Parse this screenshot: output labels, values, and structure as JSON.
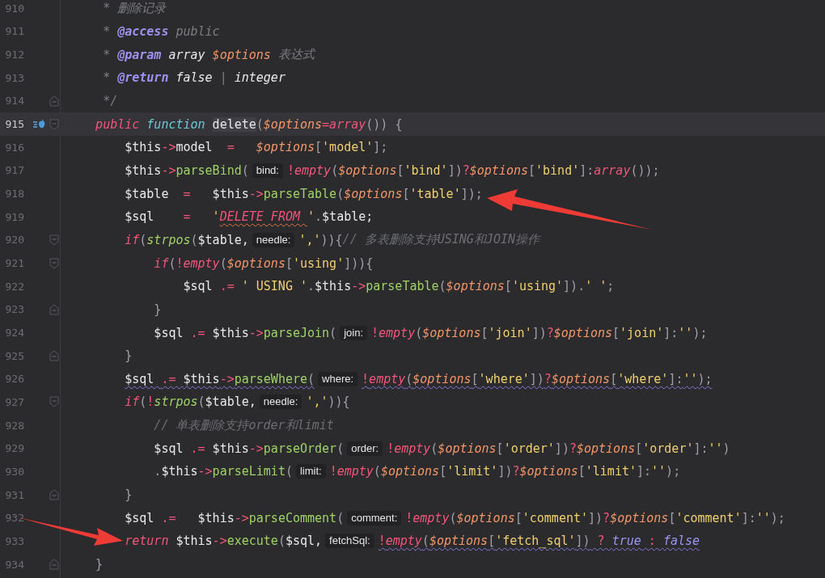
{
  "editor": {
    "lines": [
      {
        "number": "910",
        "kind": "doc",
        "current": false,
        "tokens": [
          {
            "kind": "doc",
            "text": "* 删除记录"
          }
        ]
      },
      {
        "number": "911",
        "kind": "doc",
        "current": false,
        "tokens": [
          {
            "kind": "doc",
            "text": "* "
          },
          {
            "kind": "tag",
            "text": "@access"
          },
          {
            "kind": "doc",
            "text": " public"
          }
        ]
      },
      {
        "number": "912",
        "kind": "doc",
        "current": false,
        "tokens": [
          {
            "kind": "doc",
            "text": "* "
          },
          {
            "kind": "tag",
            "text": "@param"
          },
          {
            "kind": "type",
            "text": " array "
          },
          {
            "kind": "opt",
            "text": "$options"
          },
          {
            "kind": "doc",
            "text": " 表达式"
          }
        ]
      },
      {
        "number": "913",
        "kind": "doc",
        "current": false,
        "tokens": [
          {
            "kind": "doc",
            "text": "* "
          },
          {
            "kind": "tag",
            "text": "@return"
          },
          {
            "kind": "type",
            "text": " false "
          },
          {
            "kind": "doc",
            "text": "|"
          },
          {
            "kind": "type",
            "text": " integer"
          }
        ]
      },
      {
        "number": "914",
        "kind": "doc",
        "current": false,
        "fold_close": true,
        "tokens": [
          {
            "kind": "doc",
            "text": "*/"
          }
        ]
      },
      {
        "number": "915",
        "kind": "code",
        "current": true,
        "implements_marker": true,
        "fold_open": true,
        "tokens": [
          {
            "kind": "kw",
            "text": "public"
          },
          {
            "kind": "decl",
            "text": " function "
          },
          {
            "kind": "name",
            "text": "delete",
            "highlighted": true
          },
          {
            "kind": "punc",
            "text": "("
          },
          {
            "kind": "opt",
            "text": "$options"
          },
          {
            "kind": "op",
            "text": "="
          },
          {
            "kind": "builtin",
            "text": "array"
          },
          {
            "kind": "punc",
            "text": "()) {"
          }
        ],
        "children": [
          {
            "number": "916",
            "kind": "code",
            "current": false,
            "tokens": [
              {
                "kind": "var",
                "text": "$this"
              },
              {
                "kind": "op",
                "text": "->"
              },
              {
                "kind": "var",
                "text": "model  "
              },
              {
                "kind": "op",
                "text": "=   "
              },
              {
                "kind": "opt",
                "text": "$options"
              },
              {
                "kind": "punc",
                "text": "["
              },
              {
                "kind": "str",
                "text": "'model'"
              },
              {
                "kind": "punc",
                "text": "];"
              }
            ]
          },
          {
            "number": "917",
            "kind": "code",
            "current": false,
            "tokens": [
              {
                "kind": "var",
                "text": "$this"
              },
              {
                "kind": "op",
                "text": "->"
              },
              {
                "kind": "fn",
                "text": "parseBind"
              },
              {
                "kind": "punc",
                "text": "("
              },
              {
                "kind": "hint",
                "text": "bind:"
              },
              {
                "kind": "op",
                "text": "!"
              },
              {
                "kind": "builtin",
                "text": "empty"
              },
              {
                "kind": "punc",
                "text": "("
              },
              {
                "kind": "opt",
                "text": "$options"
              },
              {
                "kind": "punc",
                "text": "["
              },
              {
                "kind": "str",
                "text": "'bind'"
              },
              {
                "kind": "punc",
                "text": "])"
              },
              {
                "kind": "op",
                "text": "?"
              },
              {
                "kind": "opt",
                "text": "$options"
              },
              {
                "kind": "punc",
                "text": "["
              },
              {
                "kind": "str",
                "text": "'bind'"
              },
              {
                "kind": "punc",
                "text": "]:"
              },
              {
                "kind": "builtin",
                "text": "array"
              },
              {
                "kind": "punc",
                "text": "());"
              }
            ]
          },
          {
            "number": "918",
            "kind": "code",
            "current": false,
            "arrow_from_right": true,
            "tokens": [
              {
                "kind": "var",
                "text": "$table  "
              },
              {
                "kind": "op",
                "text": "=   "
              },
              {
                "kind": "var",
                "text": "$this"
              },
              {
                "kind": "op",
                "text": "->"
              },
              {
                "kind": "fn",
                "text": "parseTable"
              },
              {
                "kind": "punc",
                "text": "("
              },
              {
                "kind": "opt",
                "text": "$options"
              },
              {
                "kind": "punc",
                "text": "["
              },
              {
                "kind": "str",
                "text": "'table'"
              },
              {
                "kind": "punc",
                "text": "]);"
              }
            ]
          },
          {
            "number": "919",
            "kind": "code",
            "current": false,
            "tokens": [
              {
                "kind": "var",
                "text": "$sql    "
              },
              {
                "kind": "op",
                "text": "=   "
              },
              {
                "kind": "str",
                "text": "'"
              },
              {
                "kind": "sql",
                "text": "DELETE FROM ",
                "typo": true
              },
              {
                "kind": "str",
                "text": "'"
              },
              {
                "kind": "punc",
                "text": "."
              },
              {
                "kind": "var",
                "text": "$table;"
              }
            ]
          },
          {
            "number": "920",
            "kind": "code",
            "current": false,
            "fold_open": true,
            "tokens": [
              {
                "kind": "kw",
                "text": "if"
              },
              {
                "kind": "punc",
                "text": "("
              },
              {
                "kind": "call",
                "text": "strpos"
              },
              {
                "kind": "punc",
                "text": "("
              },
              {
                "kind": "var",
                "text": "$table,"
              },
              {
                "kind": "hint",
                "text": "needle:"
              },
              {
                "kind": "str",
                "text": "','"
              },
              {
                "kind": "punc",
                "text": ")){"
              },
              {
                "kind": "comment",
                "text": "// 多表删除支持USING和JOIN操作"
              }
            ],
            "children": [
              {
                "number": "921",
                "kind": "code",
                "current": false,
                "fold_open": true,
                "tokens": [
                  {
                    "kind": "kw",
                    "text": "if"
                  },
                  {
                    "kind": "punc",
                    "text": "("
                  },
                  {
                    "kind": "op",
                    "text": "!"
                  },
                  {
                    "kind": "builtin",
                    "text": "empty"
                  },
                  {
                    "kind": "punc",
                    "text": "("
                  },
                  {
                    "kind": "opt",
                    "text": "$options"
                  },
                  {
                    "kind": "punc",
                    "text": "["
                  },
                  {
                    "kind": "str",
                    "text": "'using'"
                  },
                  {
                    "kind": "punc",
                    "text": "])){"
                  }
                ],
                "children": [
                  {
                    "number": "922",
                    "kind": "code",
                    "current": false,
                    "tokens": [
                      {
                        "kind": "var",
                        "text": "$sql "
                      },
                      {
                        "kind": "op",
                        "text": ".= "
                      },
                      {
                        "kind": "str",
                        "text": "' USING '"
                      },
                      {
                        "kind": "punc",
                        "text": "."
                      },
                      {
                        "kind": "var",
                        "text": "$this"
                      },
                      {
                        "kind": "op",
                        "text": "->"
                      },
                      {
                        "kind": "fn",
                        "text": "parseTable"
                      },
                      {
                        "kind": "punc",
                        "text": "("
                      },
                      {
                        "kind": "opt",
                        "text": "$options"
                      },
                      {
                        "kind": "punc",
                        "text": "["
                      },
                      {
                        "kind": "str",
                        "text": "'using'"
                      },
                      {
                        "kind": "punc",
                        "text": "])."
                      },
                      {
                        "kind": "str",
                        "text": "' '"
                      },
                      {
                        "kind": "punc",
                        "text": ";"
                      }
                    ]
                  }
                ]
              },
              {
                "number": "923",
                "kind": "code",
                "current": false,
                "fold_close": true,
                "tokens": [
                  {
                    "kind": "punc",
                    "text": "}"
                  }
                ]
              },
              {
                "number": "924",
                "kind": "code",
                "current": false,
                "tokens": [
                  {
                    "kind": "var",
                    "text": "$sql "
                  },
                  {
                    "kind": "op",
                    "text": ".= "
                  },
                  {
                    "kind": "var",
                    "text": "$this"
                  },
                  {
                    "kind": "op",
                    "text": "->"
                  },
                  {
                    "kind": "fn",
                    "text": "parseJoin"
                  },
                  {
                    "kind": "punc",
                    "text": "("
                  },
                  {
                    "kind": "hint",
                    "text": "join:"
                  },
                  {
                    "kind": "op",
                    "text": "!"
                  },
                  {
                    "kind": "builtin",
                    "text": "empty"
                  },
                  {
                    "kind": "punc",
                    "text": "("
                  },
                  {
                    "kind": "opt",
                    "text": "$options"
                  },
                  {
                    "kind": "punc",
                    "text": "["
                  },
                  {
                    "kind": "str",
                    "text": "'join'"
                  },
                  {
                    "kind": "punc",
                    "text": "])"
                  },
                  {
                    "kind": "op",
                    "text": "?"
                  },
                  {
                    "kind": "opt",
                    "text": "$options"
                  },
                  {
                    "kind": "punc",
                    "text": "["
                  },
                  {
                    "kind": "str",
                    "text": "'join'"
                  },
                  {
                    "kind": "punc",
                    "text": "]:"
                  },
                  {
                    "kind": "str",
                    "text": "''"
                  },
                  {
                    "kind": "punc",
                    "text": ");"
                  }
                ]
              }
            ]
          },
          {
            "number": "925",
            "kind": "code",
            "current": false,
            "fold_close": true,
            "tokens": [
              {
                "kind": "punc",
                "text": "}"
              }
            ]
          },
          {
            "number": "926",
            "kind": "code",
            "current": false,
            "tokens": [
              {
                "kind": "var",
                "text": "$sql ",
                "warning": true
              },
              {
                "kind": "op",
                "text": ".= ",
                "warning": true
              },
              {
                "kind": "var",
                "text": "$this",
                "warning": true
              },
              {
                "kind": "op",
                "text": "->",
                "warning": true
              },
              {
                "kind": "fn",
                "text": "parseWhere",
                "warning": true
              },
              {
                "kind": "punc",
                "text": "(",
                "warning": true
              },
              {
                "kind": "hint",
                "text": "where:"
              },
              {
                "kind": "op",
                "text": "!",
                "warning": true
              },
              {
                "kind": "builtin",
                "text": "empty",
                "warning": true
              },
              {
                "kind": "punc",
                "text": "(",
                "warning": true
              },
              {
                "kind": "opt",
                "text": "$options",
                "warning": true
              },
              {
                "kind": "punc",
                "text": "[",
                "warning": true
              },
              {
                "kind": "str",
                "text": "'where'",
                "warning": true
              },
              {
                "kind": "punc",
                "text": "])",
                "warning": true
              },
              {
                "kind": "op",
                "text": "?",
                "warning": true
              },
              {
                "kind": "opt",
                "text": "$options",
                "warning": true
              },
              {
                "kind": "punc",
                "text": "[",
                "warning": true
              },
              {
                "kind": "str",
                "text": "'where'",
                "warning": true
              },
              {
                "kind": "punc",
                "text": "]:",
                "warning": true
              },
              {
                "kind": "str",
                "text": "''",
                "warning": true
              },
              {
                "kind": "punc",
                "text": ");",
                "warning": true
              }
            ]
          },
          {
            "number": "927",
            "kind": "code",
            "current": false,
            "fold_open": true,
            "tokens": [
              {
                "kind": "kw",
                "text": "if"
              },
              {
                "kind": "punc",
                "text": "("
              },
              {
                "kind": "op",
                "text": "!"
              },
              {
                "kind": "call",
                "text": "strpos"
              },
              {
                "kind": "punc",
                "text": "("
              },
              {
                "kind": "var",
                "text": "$table,"
              },
              {
                "kind": "hint",
                "text": "needle:"
              },
              {
                "kind": "str",
                "text": "','"
              },
              {
                "kind": "punc",
                "text": ")){"
              }
            ],
            "children": [
              {
                "number": "928",
                "kind": "code",
                "current": false,
                "tokens": [
                  {
                    "kind": "comment",
                    "text": "// 单表删除支持order和limit"
                  }
                ]
              },
              {
                "number": "929",
                "kind": "code",
                "current": false,
                "tokens": [
                  {
                    "kind": "var",
                    "text": "$sql "
                  },
                  {
                    "kind": "op",
                    "text": ".= "
                  },
                  {
                    "kind": "var",
                    "text": "$this"
                  },
                  {
                    "kind": "op",
                    "text": "->"
                  },
                  {
                    "kind": "fn",
                    "text": "parseOrder"
                  },
                  {
                    "kind": "punc",
                    "text": "("
                  },
                  {
                    "kind": "hint",
                    "text": "order:"
                  },
                  {
                    "kind": "op",
                    "text": "!"
                  },
                  {
                    "kind": "builtin",
                    "text": "empty"
                  },
                  {
                    "kind": "punc",
                    "text": "("
                  },
                  {
                    "kind": "opt",
                    "text": "$options"
                  },
                  {
                    "kind": "punc",
                    "text": "["
                  },
                  {
                    "kind": "str",
                    "text": "'order'"
                  },
                  {
                    "kind": "punc",
                    "text": "])"
                  },
                  {
                    "kind": "op",
                    "text": "?"
                  },
                  {
                    "kind": "opt",
                    "text": "$options"
                  },
                  {
                    "kind": "punc",
                    "text": "["
                  },
                  {
                    "kind": "str",
                    "text": "'order'"
                  },
                  {
                    "kind": "punc",
                    "text": "]:"
                  },
                  {
                    "kind": "str",
                    "text": "''"
                  },
                  {
                    "kind": "punc",
                    "text": ")"
                  }
                ]
              },
              {
                "number": "930",
                "kind": "code",
                "current": false,
                "tokens": [
                  {
                    "kind": "punc",
                    "text": "."
                  },
                  {
                    "kind": "var",
                    "text": "$this"
                  },
                  {
                    "kind": "op",
                    "text": "->"
                  },
                  {
                    "kind": "fn",
                    "text": "parseLimit"
                  },
                  {
                    "kind": "punc",
                    "text": "("
                  },
                  {
                    "kind": "hint",
                    "text": "limit:"
                  },
                  {
                    "kind": "op",
                    "text": "!"
                  },
                  {
                    "kind": "builtin",
                    "text": "empty"
                  },
                  {
                    "kind": "punc",
                    "text": "("
                  },
                  {
                    "kind": "opt",
                    "text": "$options"
                  },
                  {
                    "kind": "punc",
                    "text": "["
                  },
                  {
                    "kind": "str",
                    "text": "'limit'"
                  },
                  {
                    "kind": "punc",
                    "text": "])"
                  },
                  {
                    "kind": "op",
                    "text": "?"
                  },
                  {
                    "kind": "opt",
                    "text": "$options"
                  },
                  {
                    "kind": "punc",
                    "text": "["
                  },
                  {
                    "kind": "str",
                    "text": "'limit'"
                  },
                  {
                    "kind": "punc",
                    "text": "]:"
                  },
                  {
                    "kind": "str",
                    "text": "''"
                  },
                  {
                    "kind": "punc",
                    "text": ");"
                  }
                ]
              }
            ]
          },
          {
            "number": "931",
            "kind": "code",
            "current": false,
            "fold_close": true,
            "tokens": [
              {
                "kind": "punc",
                "text": "}"
              }
            ]
          },
          {
            "number": "932",
            "kind": "code",
            "current": false,
            "tokens": [
              {
                "kind": "var",
                "text": "$sql "
              },
              {
                "kind": "op",
                "text": ".=   "
              },
              {
                "kind": "var",
                "text": "$this"
              },
              {
                "kind": "op",
                "text": "->"
              },
              {
                "kind": "fn",
                "text": "parseComment"
              },
              {
                "kind": "punc",
                "text": "("
              },
              {
                "kind": "hint",
                "text": "comment:"
              },
              {
                "kind": "op",
                "text": "!"
              },
              {
                "kind": "builtin",
                "text": "empty"
              },
              {
                "kind": "punc",
                "text": "("
              },
              {
                "kind": "opt",
                "text": "$options"
              },
              {
                "kind": "punc",
                "text": "["
              },
              {
                "kind": "str",
                "text": "'comment'"
              },
              {
                "kind": "punc",
                "text": "])"
              },
              {
                "kind": "op",
                "text": "?"
              },
              {
                "kind": "opt",
                "text": "$options"
              },
              {
                "kind": "punc",
                "text": "["
              },
              {
                "kind": "str",
                "text": "'comment'"
              },
              {
                "kind": "punc",
                "text": "]:"
              },
              {
                "kind": "str",
                "text": "''"
              },
              {
                "kind": "punc",
                "text": ");"
              }
            ]
          },
          {
            "number": "933",
            "kind": "code",
            "current": false,
            "arrow_from_left": true,
            "tokens": [
              {
                "kind": "kw",
                "text": "return"
              },
              {
                "kind": "var",
                "text": " $this"
              },
              {
                "kind": "op",
                "text": "->"
              },
              {
                "kind": "fn",
                "text": "execute"
              },
              {
                "kind": "punc",
                "text": "("
              },
              {
                "kind": "var",
                "text": "$sql,"
              },
              {
                "kind": "hint",
                "text": "fetchSql:"
              },
              {
                "kind": "op",
                "text": "!",
                "warning": true
              },
              {
                "kind": "builtin",
                "text": "empty",
                "warning": true
              },
              {
                "kind": "punc",
                "text": "(",
                "warning": true
              },
              {
                "kind": "opt",
                "text": "$options",
                "warning": true
              },
              {
                "kind": "punc",
                "text": "[",
                "warning": true
              },
              {
                "kind": "str",
                "text": "'fetch_sql'",
                "warning": true
              },
              {
                "kind": "punc",
                "text": "])",
                "warning": true
              },
              {
                "kind": "op",
                "text": " ? ",
                "warning": true
              },
              {
                "kind": "const",
                "text": "true",
                "warning": true
              },
              {
                "kind": "op",
                "text": " : ",
                "warning": true
              },
              {
                "kind": "const",
                "text": "false",
                "warning": true
              }
            ]
          }
        ]
      },
      {
        "number": "934",
        "kind": "code",
        "current": false,
        "fold_close": true,
        "tokens": [
          {
            "kind": "punc",
            "text": "}"
          }
        ]
      }
    ]
  }
}
